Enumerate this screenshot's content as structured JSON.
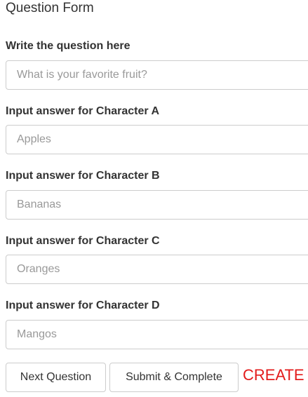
{
  "form": {
    "title": "Question Form",
    "question": {
      "label": "Write the question here",
      "placeholder": "What is your favorite fruit?",
      "value": ""
    },
    "answers": [
      {
        "label": "Input answer for Character A",
        "placeholder": "Apples",
        "value": ""
      },
      {
        "label": "Input answer for Character B",
        "placeholder": "Bananas",
        "value": ""
      },
      {
        "label": "Input answer for Character C",
        "placeholder": "Oranges",
        "value": ""
      },
      {
        "label": "Input answer for Character D",
        "placeholder": "Mangos",
        "value": ""
      }
    ]
  },
  "actions": {
    "next_label": "Next Question",
    "submit_label": "Submit & Complete",
    "create_label": "CREATE"
  },
  "colors": {
    "create_link": "#e31b1b",
    "input_border": "#cccccc",
    "placeholder": "#999999",
    "text": "#333333"
  }
}
